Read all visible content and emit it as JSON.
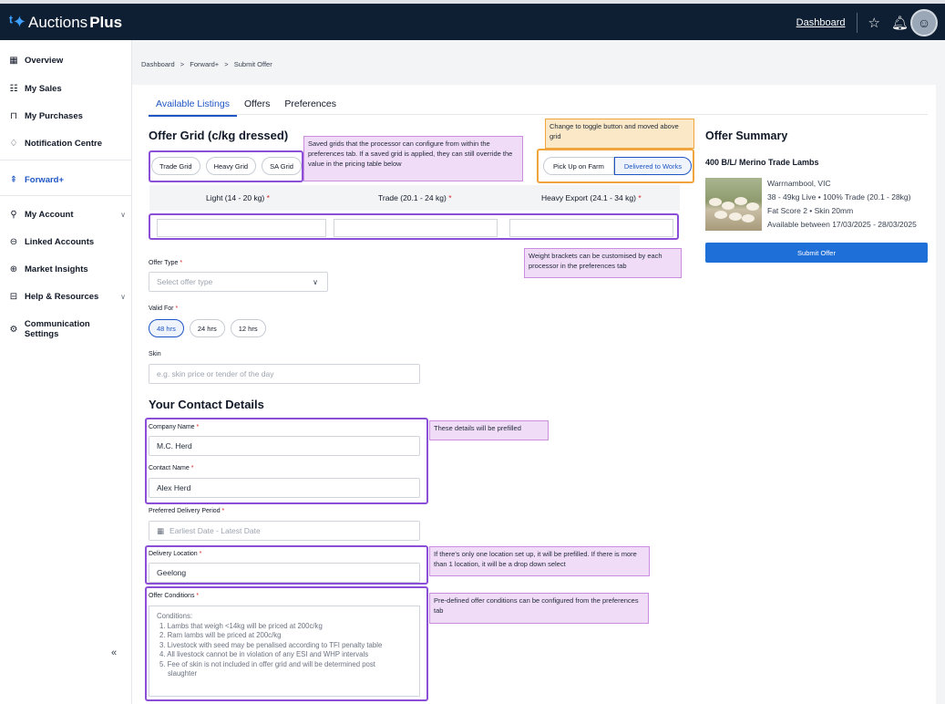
{
  "app": {
    "logo_prefix": "Auctions",
    "logo_bold": "Plus"
  },
  "topbar": {
    "dashboard_link": "Dashboard"
  },
  "sidebar": {
    "items": [
      {
        "label": "Overview",
        "icon": "grid-icon"
      },
      {
        "label": "My Sales",
        "icon": "list-icon"
      },
      {
        "label": "My Purchases",
        "icon": "bag-icon"
      },
      {
        "label": "Notification Centre",
        "icon": "bell-icon"
      },
      {
        "label": "Forward+",
        "icon": "forward-icon"
      },
      {
        "label": "My Account",
        "icon": "user-icon"
      },
      {
        "label": "Linked Accounts",
        "icon": "link-icon"
      },
      {
        "label": "Market Insights",
        "icon": "chart-search-icon"
      },
      {
        "label": "Help & Resources",
        "icon": "book-icon"
      },
      {
        "label": "Communication Settings",
        "icon": "settings-icon"
      }
    ],
    "collapse_label": "«"
  },
  "breadcrumb": {
    "items": [
      "Dashboard",
      "Forward+",
      "Submit Offer"
    ],
    "sep": ">"
  },
  "tabs": [
    "Available Listings",
    "Offers",
    "Preferences"
  ],
  "offer_grid": {
    "title": "Offer Grid (c/kg dressed)",
    "saved_grids": [
      "Trade Grid",
      "Heavy Grid",
      "SA Grid"
    ],
    "delivery_toggle": [
      "Pick Up on Farm",
      "Delivered to Works"
    ],
    "columns": [
      "Light (14 - 20 kg)",
      "Trade (20.1 - 24 kg)",
      "Heavy Export (24.1 - 34 kg)"
    ],
    "required_mark": "*"
  },
  "form": {
    "offer_type_label": "Offer Type",
    "offer_type_placeholder": "Select offer type",
    "valid_for_label": "Valid For",
    "valid_for_options": [
      "48 hrs",
      "24 hrs",
      "12 hrs"
    ],
    "skin_label": "Skin",
    "skin_placeholder": "e.g. skin price or tender of the day",
    "contact_title": "Your Contact Details",
    "company_label": "Company Name",
    "company_value": "M.C. Herd",
    "contact_label": "Contact Name",
    "contact_value": "Alex Herd",
    "delivery_period_label": "Preferred Delivery Period",
    "delivery_period_placeholder": "Earliest Date - Latest Date",
    "delivery_location_label": "Delivery Location",
    "delivery_location_value": "Geelong",
    "conditions_label": "Offer Conditions",
    "conditions_heading": "Conditions:",
    "conditions": [
      "1. Lambs that weigh <14kg will be priced at 200c/kg",
      "2. Ram lambs will be priced at 200c/kg",
      "3. Livestock with seed may be penalised according to TFI penalty table",
      "4. All livestock cannot be in violation of any ESI and WHP intervals",
      "5. Fee of skin is not included in offer grid and will be determined post",
      "slaughter"
    ]
  },
  "annotations": {
    "saved_grids": "Saved grids that the processor can configure from within the preferences tab. If a saved grid is applied, they can still override the value in the pricing table below",
    "toggle": "Change to toggle button and moved above grid",
    "weights": "Weight brackets can be customised by each processor in the preferences tab",
    "prefilled": "These details will be prefilled",
    "location": "If there's only one location set up, it will be prefilled. If there is more than 1 location, it will be a drop down select",
    "conditions": "Pre-defined offer conditions can be configured from the preferences tab"
  },
  "summary": {
    "title": "Offer Summary",
    "listing": "400 B/L/ Merino Trade Lambs",
    "location": "Warrnambool, VIC",
    "details1": "38 - 49kg Live • 100% Trade (20.1 - 28kg)",
    "details2": "Fat Score 2 • Skin 20mm",
    "availability": "Available between 17/03/2025 - 28/03/2025",
    "submit_label": "Submit Offer"
  }
}
